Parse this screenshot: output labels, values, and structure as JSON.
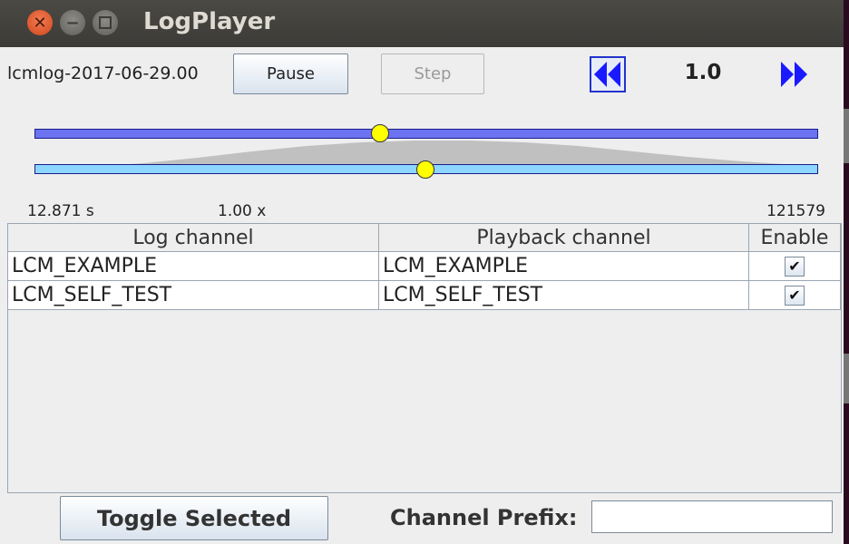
{
  "window": {
    "title": "LogPlayer"
  },
  "controls": {
    "log_name": "lcmlog-2017-06-29.00",
    "pause_label": "Pause",
    "step_label": "Step",
    "speed_value": "1.0"
  },
  "timeline": {
    "time_label": "12.871 s",
    "rate_label": "1.00 x",
    "total_label": "121579",
    "position_fraction": 0.44,
    "jump_fraction": 0.5
  },
  "table": {
    "headers": [
      "Log channel",
      "Playback channel",
      "Enable"
    ],
    "rows": [
      {
        "log_channel": "LCM_EXAMPLE",
        "playback_channel": "LCM_EXAMPLE",
        "enabled": true
      },
      {
        "log_channel": "LCM_SELF_TEST",
        "playback_channel": "LCM_SELF_TEST",
        "enabled": true
      }
    ]
  },
  "footer": {
    "toggle_label": "Toggle Selected",
    "prefix_label": "Channel Prefix:",
    "prefix_value": ""
  },
  "colors": {
    "track_top": "#6b73f0",
    "track_bottom": "#8cd6ff",
    "knob": "#ffff00",
    "ff_arrows": "#1a1aff"
  }
}
